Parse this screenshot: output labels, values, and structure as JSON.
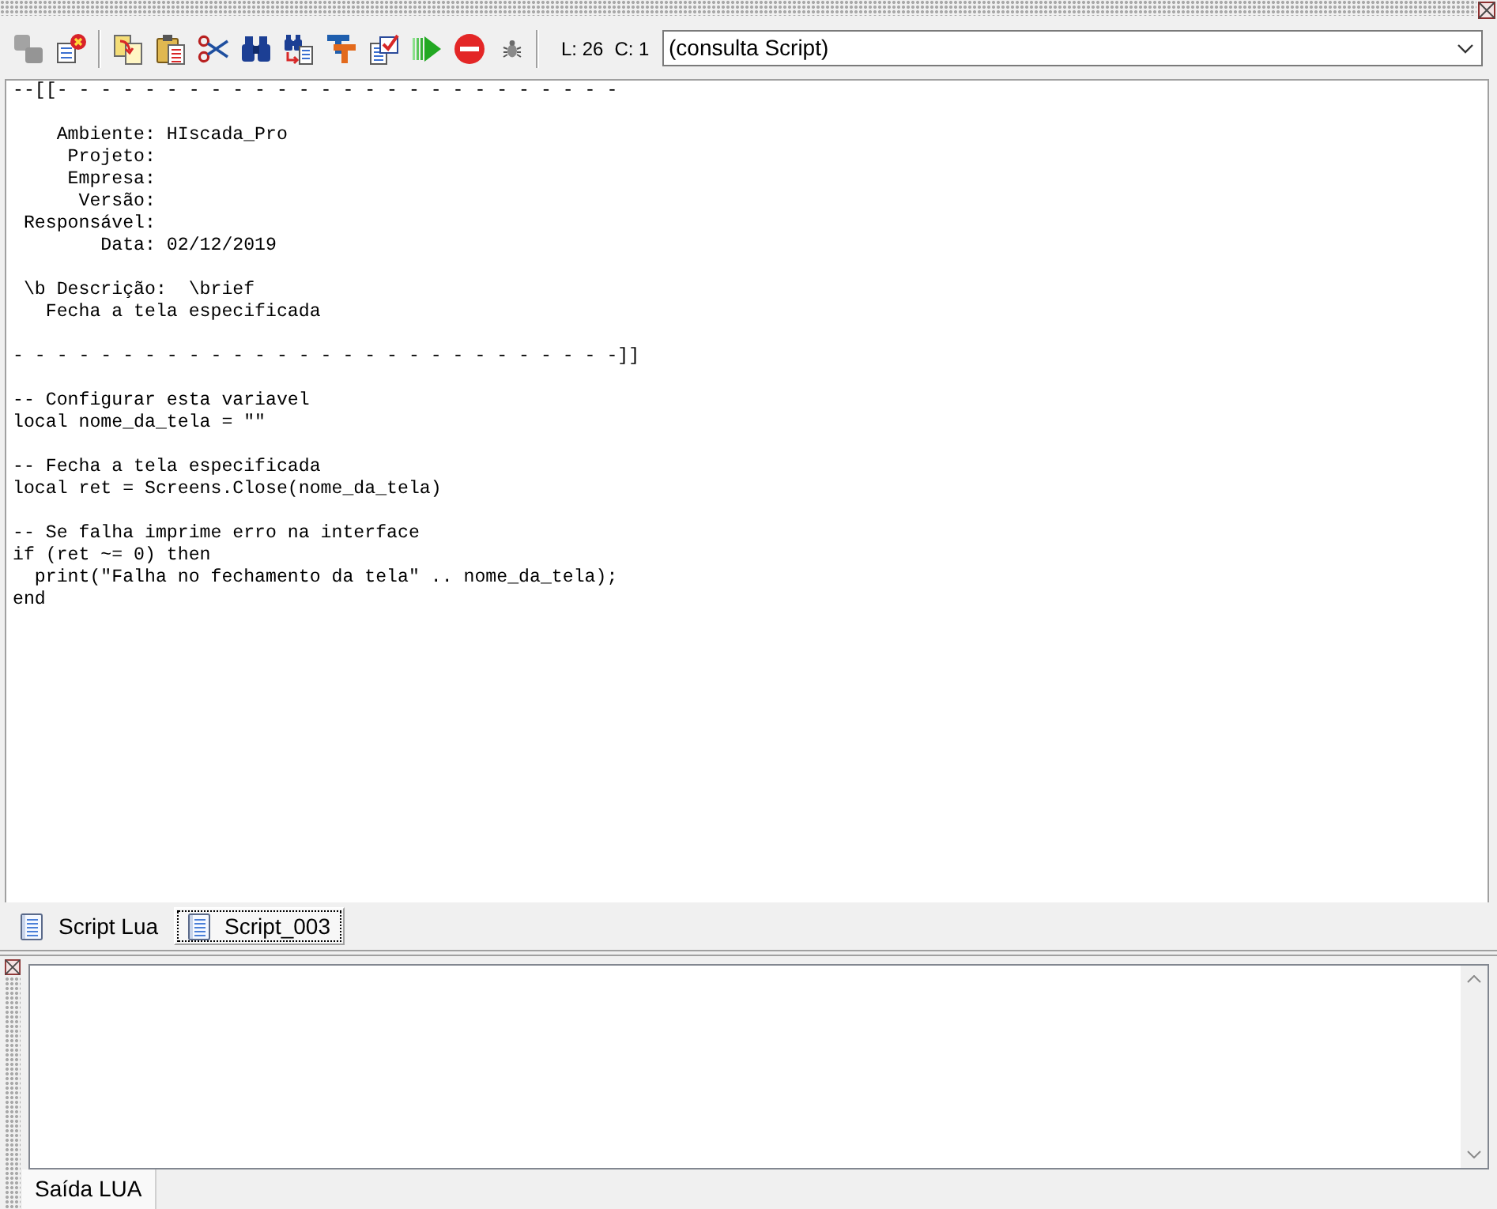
{
  "toolbar": {
    "groups": [
      [
        {
          "kind": "layers",
          "disabled": true
        },
        {
          "kind": "delete_document",
          "disabled": false
        }
      ],
      [
        {
          "kind": "copy",
          "disabled": false
        },
        {
          "kind": "paste",
          "disabled": false
        },
        {
          "kind": "cut",
          "disabled": false
        },
        {
          "kind": "find",
          "disabled": false
        },
        {
          "kind": "replace",
          "disabled": false
        },
        {
          "kind": "font",
          "disabled": false
        },
        {
          "kind": "checklist",
          "disabled": false
        },
        {
          "kind": "run",
          "disabled": false
        },
        {
          "kind": "stop",
          "disabled": false
        },
        {
          "kind": "debug",
          "disabled": false
        }
      ]
    ],
    "cursor_position": {
      "line": "L: 26",
      "column": "C: 1"
    },
    "function_dropdown": {
      "value": "(consulta Script)"
    }
  },
  "editor": {
    "blocks": [
      [
        "--[[- - - - - - - - - - - - - - - - - - - - - - - - - -"
      ],
      [
        "    Ambiente: HIscada_Pro",
        "     Projeto:",
        "     Empresa:",
        "      Versão:",
        " Responsável:",
        "        Data: 02/12/2019"
      ],
      [
        " \\b Descrição:  \\brief",
        "   Fecha a tela especificada"
      ],
      [
        "- - - - - - - - - - - - - - - - - - - - - - - - - - - -]]"
      ],
      [
        "-- Configurar esta variavel",
        "local nome_da_tela = \"\""
      ],
      [
        "-- Fecha a tela especificada",
        "local ret = Screens.Close(nome_da_tela)"
      ],
      [
        "-- Se falha imprime erro na interface",
        "if (ret ~= 0) then",
        "  print(\"Falha no fechamento da tela\" .. nome_da_tela);",
        "end"
      ]
    ]
  },
  "editor_tabs": [
    {
      "label": "Script Lua",
      "selected": false
    },
    {
      "label": "Script_003",
      "selected": true
    }
  ],
  "output_panel": {
    "tabs": [
      {
        "label": "Saída LUA",
        "selected": true
      }
    ]
  }
}
